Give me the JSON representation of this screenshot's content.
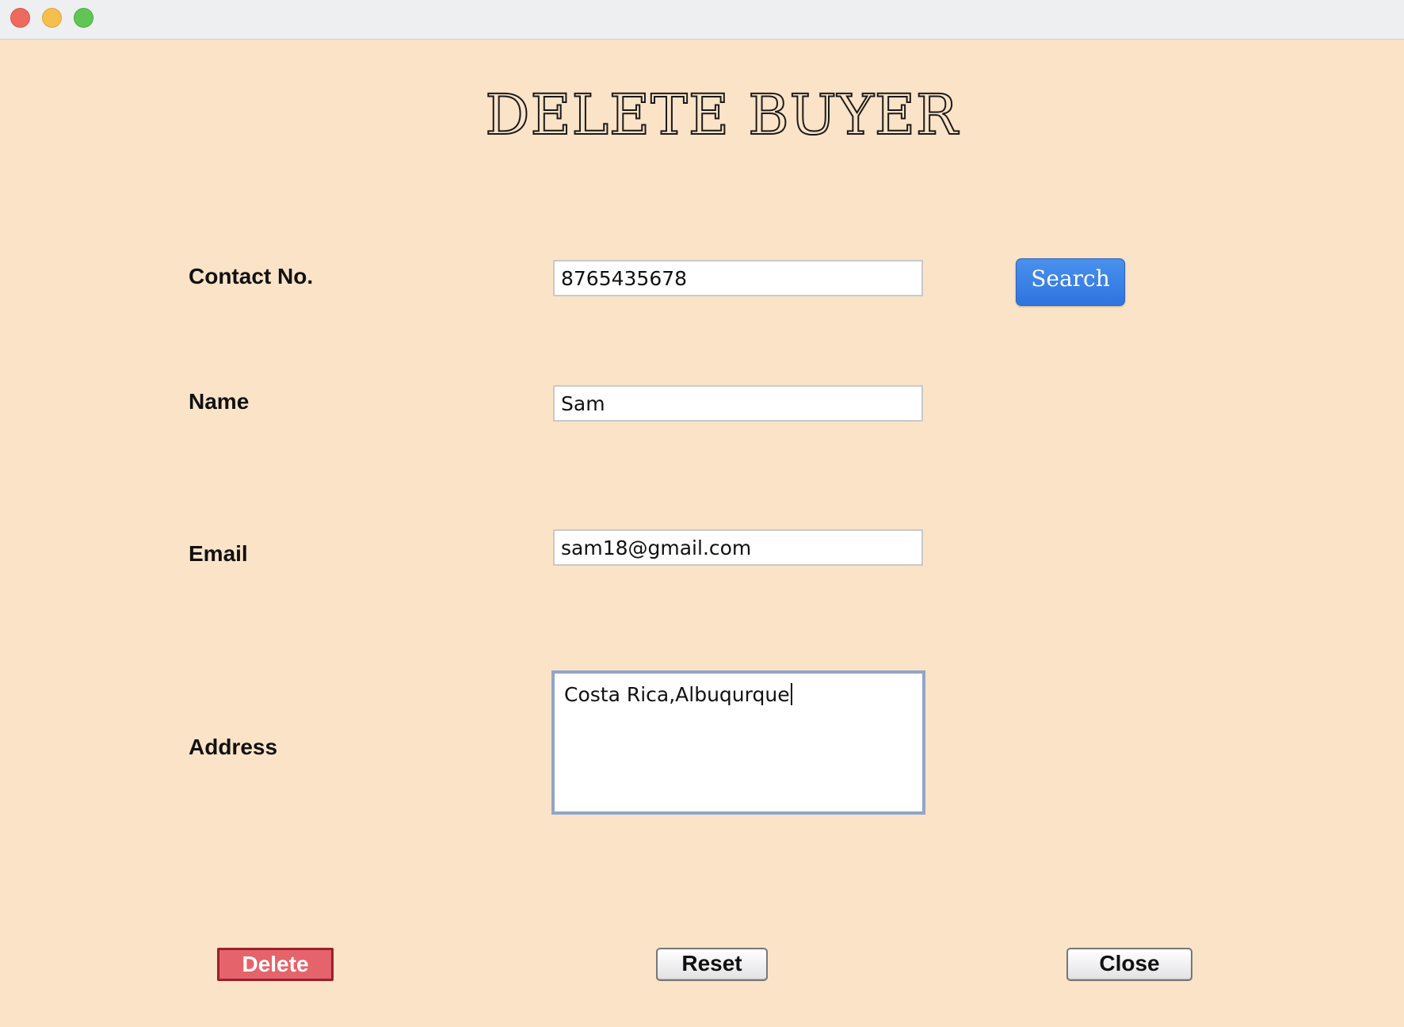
{
  "window": {
    "title": ""
  },
  "page": {
    "title": "DELETE BUYER"
  },
  "form": {
    "contact": {
      "label": "Contact No.",
      "value": "8765435678"
    },
    "name": {
      "label": "Name",
      "value": "Sam"
    },
    "email": {
      "label": "Email",
      "value": "sam18@gmail.com"
    },
    "address": {
      "label": "Address",
      "value": "Costa Rica,Albuqurque"
    }
  },
  "buttons": {
    "search": "Search",
    "delete": "Delete",
    "reset": "Reset",
    "close": "Close"
  },
  "colors": {
    "background": "#fae3c7",
    "search_button": "#3a80e8",
    "delete_button": "#e5636a"
  }
}
